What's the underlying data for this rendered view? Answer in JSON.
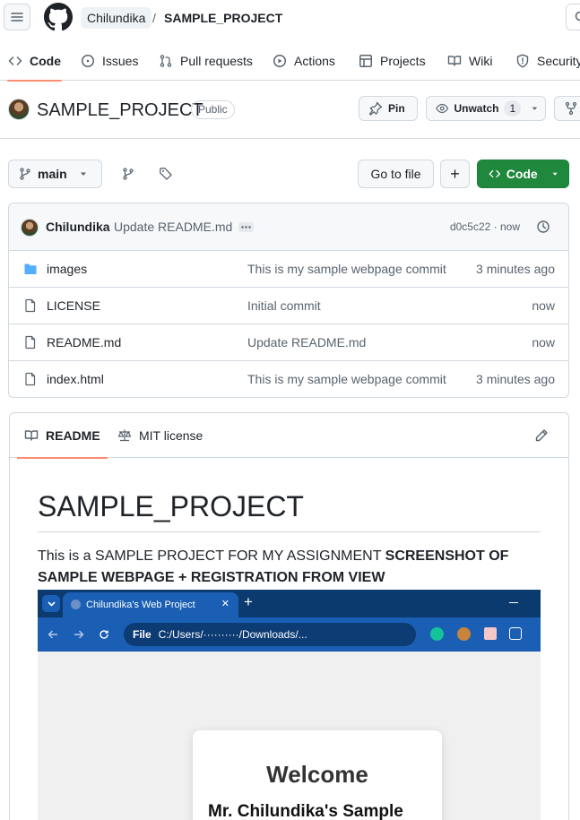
{
  "header": {
    "owner": "Chilundika",
    "separator": "/",
    "repo": "SAMPLE_PROJECT"
  },
  "nav": {
    "tabs": [
      {
        "label": "Code",
        "icon": "code-icon",
        "active": true
      },
      {
        "label": "Issues",
        "icon": "issue-icon"
      },
      {
        "label": "Pull requests",
        "icon": "pull-request-icon"
      },
      {
        "label": "Actions",
        "icon": "play-icon"
      },
      {
        "label": "Projects",
        "icon": "table-icon"
      },
      {
        "label": "Wiki",
        "icon": "book-icon"
      },
      {
        "label": "Security",
        "icon": "shield-icon"
      }
    ]
  },
  "repo": {
    "name": "SAMPLE_PROJECT",
    "visibility": "Public",
    "pin_label": "Pin",
    "unwatch_label": "Unwatch",
    "watch_count": "1"
  },
  "toolbar": {
    "branch": "main",
    "go_to_file": "Go to file",
    "add_label": "+",
    "code_label": "Code"
  },
  "commit": {
    "author": "Chilundika",
    "message": "Update README.md",
    "sha_time": "d0c5c22 · now"
  },
  "files": [
    {
      "name": "images",
      "type": "folder",
      "message": "This is my sample webpage commit",
      "age": "3 minutes ago"
    },
    {
      "name": "LICENSE",
      "type": "file",
      "message": "Initial commit",
      "age": "now"
    },
    {
      "name": "README.md",
      "type": "file",
      "message": "Update README.md",
      "age": "now"
    },
    {
      "name": "index.html",
      "type": "file",
      "message": "This is my sample webpage commit",
      "age": "3 minutes ago"
    }
  ],
  "readme": {
    "tab_readme": "README",
    "tab_license": "MIT license",
    "heading": "SAMPLE_PROJECT",
    "para_plain": "This is a SAMPLE PROJECT FOR MY ASSIGNMENT ",
    "para_bold": "SCREENSHOT OF SAMPLE WEBPAGE + REGISTRATION FROM VIEW"
  },
  "screenshot": {
    "tab_title": "Chilundika's Web Project",
    "tab_close": "✕",
    "new_tab": "+",
    "url_prefix": "File",
    "url": "C:/Users/··········/Downloads/...",
    "welcome": "Welcome",
    "subtitle": "Mr. Chilundika's Sample"
  },
  "colors": {
    "accent_underline": "#fd8c73",
    "code_button": "#1f883d",
    "folder": "#54aeff",
    "browser_tabbar": "#0b3a6f",
    "browser_toolbar": "#1a5fb4"
  }
}
